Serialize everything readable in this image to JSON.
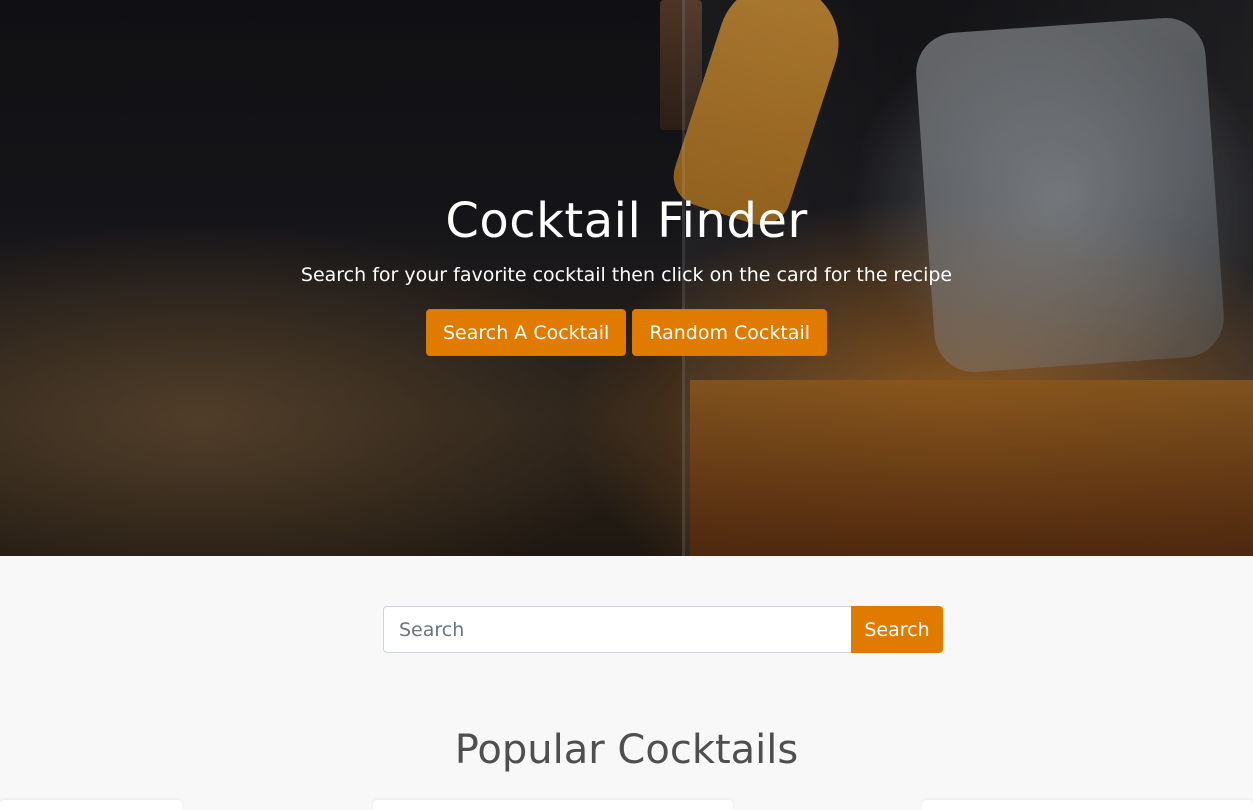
{
  "hero": {
    "title": "Cocktail Finder",
    "subtitle": "Search for your favorite cocktail then click on the card for the recipe",
    "buttons": {
      "search": "Search A Cocktail",
      "random": "Random Cocktail"
    },
    "background_image": "cocktail glass with ice and orange peel"
  },
  "search": {
    "placeholder": "Search",
    "value": "",
    "button_label": "Search"
  },
  "popular": {
    "title": "Popular Cocktails"
  },
  "colors": {
    "accent": "#e07b00",
    "page_background": "#f8f8f8",
    "heading": "#4f4f4f"
  }
}
